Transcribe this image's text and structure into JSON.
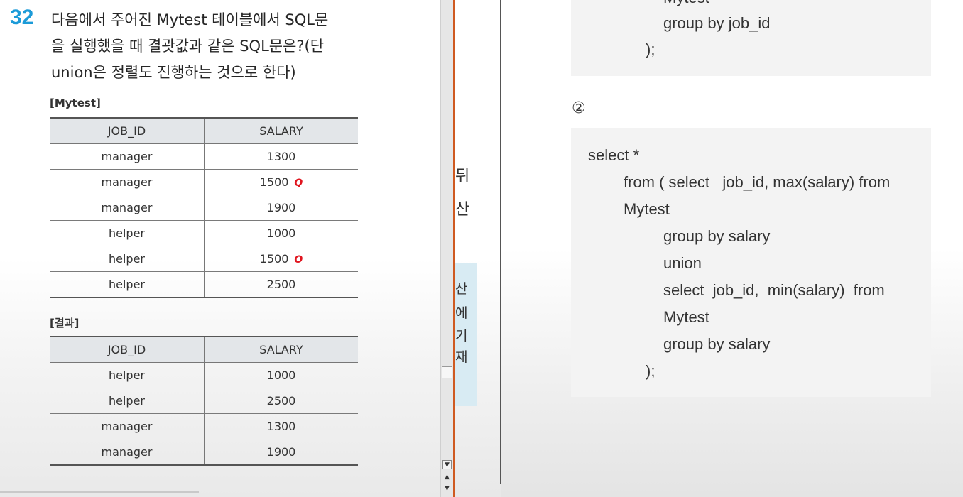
{
  "question": {
    "number": "32",
    "lines": [
      "다음에서 주어진 Mytest 테이블에서 SQL문",
      "을 실행했을 때 결괏값과 같은 SQL문은?(단",
      "union은 정렬도 진행하는 것으로 한다)"
    ]
  },
  "mytest": {
    "label": "[Mytest]",
    "headers": [
      "JOB_ID",
      "SALARY"
    ],
    "rows": [
      [
        "manager",
        "1300",
        ""
      ],
      [
        "manager",
        "1500",
        "Q"
      ],
      [
        "manager",
        "1900",
        ""
      ],
      [
        "helper",
        "1000",
        ""
      ],
      [
        "helper",
        "1500",
        "O"
      ],
      [
        "helper",
        "2500",
        ""
      ]
    ]
  },
  "result": {
    "label": "[결과]",
    "headers": [
      "JOB_ID",
      "SALARY"
    ],
    "rows": [
      [
        "helper",
        "1000"
      ],
      [
        "helper",
        "2500"
      ],
      [
        "manager",
        "1300"
      ],
      [
        "manager",
        "1900"
      ]
    ]
  },
  "middle_fragments": [
    "ㅤ",
    "뒤",
    "산",
    "산",
    "에",
    "기",
    "재"
  ],
  "option1_tail": {
    "lines": [
      "Mytest",
      "group by job_id",
      ");"
    ]
  },
  "option2": {
    "marker": "②",
    "lines": [
      "select *",
      "from ( select   job_id, max(salary) from",
      "Mytest",
      "group by salary",
      "union",
      "select  job_id,  min(salary)  from",
      "Mytest",
      "group by salary",
      ");"
    ]
  }
}
